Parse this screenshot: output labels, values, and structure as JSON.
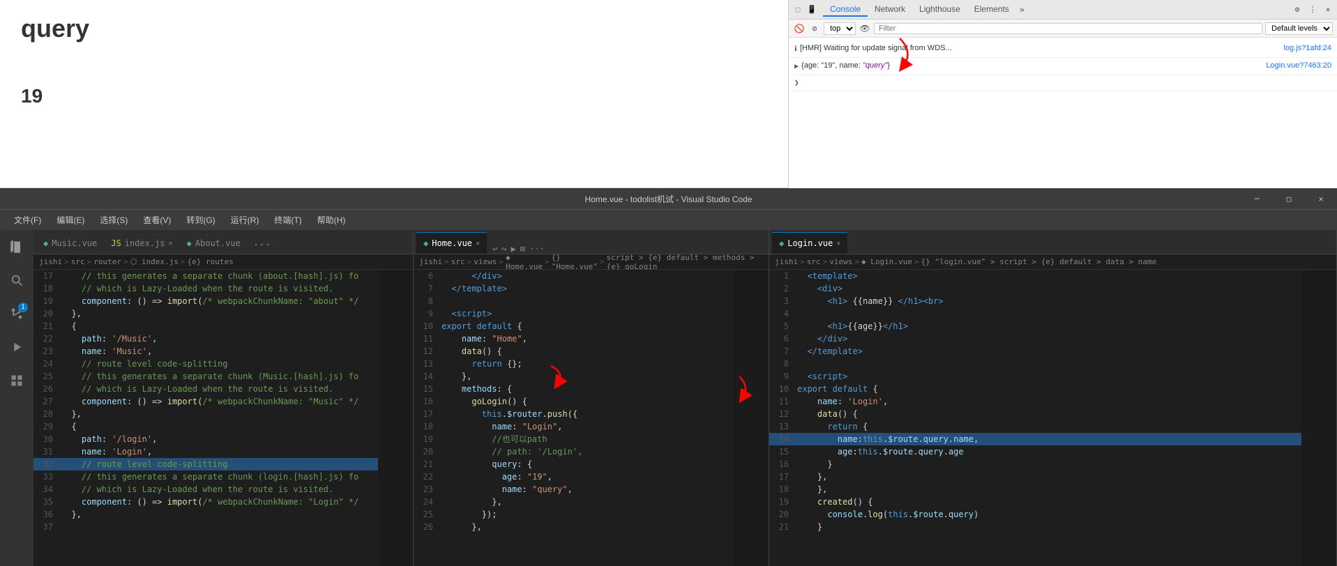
{
  "browser": {
    "preview_title": "query",
    "preview_number": "19"
  },
  "devtools": {
    "tabs": [
      "Console",
      "Network",
      "Lighthouse",
      "Elements"
    ],
    "active_tab": "Console",
    "toolbar": {
      "top_label": "top",
      "filter_placeholder": "Filter",
      "default_levels": "Default levels"
    },
    "console_lines": [
      {
        "type": "hmr",
        "text": "[HMR] Waiting for update signal from WDS...",
        "link": "log.js?1afd:24"
      },
      {
        "type": "object",
        "text": "{age: \"19\", name: \"query\"}",
        "link": "Login.vue?7463:20"
      },
      {
        "type": "prompt",
        "text": ">"
      }
    ]
  },
  "vscode": {
    "title": "Home.vue - todolist机试 - Visual Studio Code",
    "menubar": [
      "文件(F)",
      "编辑(E)",
      "选择(S)",
      "查看(V)",
      "转到(G)",
      "运行(R)",
      "终端(T)",
      "帮助(H)"
    ],
    "panels": [
      {
        "id": "panel1",
        "tabs": [
          {
            "label": "Music.vue",
            "type": "vue",
            "active": false,
            "closable": false
          },
          {
            "label": "index.js",
            "type": "js",
            "active": false,
            "closable": true
          },
          {
            "label": "About.vue",
            "type": "vue",
            "active": false,
            "closable": false
          }
        ],
        "more": "...",
        "breadcrumb": "jishi > src > router > index.js > {e} routes",
        "lines": [
          {
            "num": 17,
            "content": "    // this generates a separate chunk (about.[hash].js) fo"
          },
          {
            "num": 18,
            "content": "    // which is Lazy-Loaded when the route is visited."
          },
          {
            "num": 19,
            "content": "    component: () => import(/* webpackChunkName: \"about\" */"
          },
          {
            "num": 20,
            "content": "  },"
          },
          {
            "num": 21,
            "content": "  {"
          },
          {
            "num": 22,
            "content": "    path: '/Music',"
          },
          {
            "num": 23,
            "content": "    name: 'Music',"
          },
          {
            "num": 24,
            "content": "    // route level code-splitting"
          },
          {
            "num": 25,
            "content": "    // this generates a separate chunk (Music.[hash].js) fo"
          },
          {
            "num": 26,
            "content": "    // which is Lazy-Loaded when the route is visited."
          },
          {
            "num": 27,
            "content": "    component: () => import(/* webpackChunkName: \"Music\" */"
          },
          {
            "num": 28,
            "content": "  },"
          },
          {
            "num": 29,
            "content": "  {"
          },
          {
            "num": 30,
            "content": "    path: '/login',"
          },
          {
            "num": 31,
            "content": "    name: 'Login',"
          },
          {
            "num": 32,
            "content": "    // route level code-splitting",
            "highlighted": true
          },
          {
            "num": 33,
            "content": "    // this generates a separate chunk (login.[hash].js) fo"
          },
          {
            "num": 34,
            "content": "    // which is Lazy-Loaded when the route is visited."
          },
          {
            "num": 35,
            "content": "    component: () => import(/* webpackChunkName: \"Login\" */"
          },
          {
            "num": 36,
            "content": "  },"
          },
          {
            "num": 37,
            "content": ""
          }
        ]
      },
      {
        "id": "panel2",
        "tabs": [
          {
            "label": "Home.vue",
            "type": "vue",
            "active": true,
            "closable": true
          }
        ],
        "more": "",
        "breadcrumb": "jishi > src > views > Home.vue > {} \"Home.vue\" > script > {e} default > methods > {e} goLogin",
        "lines": [
          {
            "num": 6,
            "content": "      </div>"
          },
          {
            "num": 7,
            "content": "  </template>"
          },
          {
            "num": 8,
            "content": ""
          },
          {
            "num": 9,
            "content": "  <script>"
          },
          {
            "num": 10,
            "content": "export default {"
          },
          {
            "num": 11,
            "content": "    name: \"Home\","
          },
          {
            "num": 12,
            "content": "    data() {"
          },
          {
            "num": 13,
            "content": "      return {};"
          },
          {
            "num": 14,
            "content": "    },"
          },
          {
            "num": 15,
            "content": "    methods: {"
          },
          {
            "num": 16,
            "content": "      goLogin() {"
          },
          {
            "num": 17,
            "content": "        this.$router.push({"
          },
          {
            "num": 18,
            "content": "          name: \"Login\","
          },
          {
            "num": 19,
            "content": "          //也可以path"
          },
          {
            "num": 20,
            "content": "          // path: '/Login',"
          },
          {
            "num": 21,
            "content": "          query: {",
            "highlighted": false
          },
          {
            "num": 22,
            "content": "            age: \"19\","
          },
          {
            "num": 23,
            "content": "            name: \"query\","
          },
          {
            "num": 24,
            "content": "          },"
          },
          {
            "num": 25,
            "content": "        });"
          },
          {
            "num": 26,
            "content": "      },"
          }
        ]
      },
      {
        "id": "panel3",
        "tabs": [
          {
            "label": "Login.vue",
            "type": "vue",
            "active": true,
            "closable": true
          }
        ],
        "more": "",
        "breadcrumb": "jishi > src > views > Login.vue > {} \"login.vue\" > script > {e} default > data > name",
        "lines": [
          {
            "num": 1,
            "content": "  <template>"
          },
          {
            "num": 2,
            "content": "    <div>"
          },
          {
            "num": 3,
            "content": "      <h1> {{name}} </h1><br>"
          },
          {
            "num": 4,
            "content": ""
          },
          {
            "num": 5,
            "content": "      <h1>{{age}}</h1>"
          },
          {
            "num": 6,
            "content": "    </div>"
          },
          {
            "num": 7,
            "content": "  </template>"
          },
          {
            "num": 8,
            "content": ""
          },
          {
            "num": 9,
            "content": "  <script>"
          },
          {
            "num": 10,
            "content": "export default {"
          },
          {
            "num": 11,
            "content": "    name: 'Login',"
          },
          {
            "num": 12,
            "content": "    data() {"
          },
          {
            "num": 13,
            "content": "      return {"
          },
          {
            "num": 14,
            "content": "        name:this.$route.query.name,",
            "highlighted": true
          },
          {
            "num": 15,
            "content": "        age:this.$route.query.age"
          },
          {
            "num": 16,
            "content": "      }"
          },
          {
            "num": 17,
            "content": "    },"
          },
          {
            "num": 18,
            "content": "    },"
          },
          {
            "num": 19,
            "content": "    created() {"
          },
          {
            "num": 20,
            "content": "      console.log(this.$route.query)"
          },
          {
            "num": 21,
            "content": "    }"
          }
        ]
      }
    ]
  }
}
